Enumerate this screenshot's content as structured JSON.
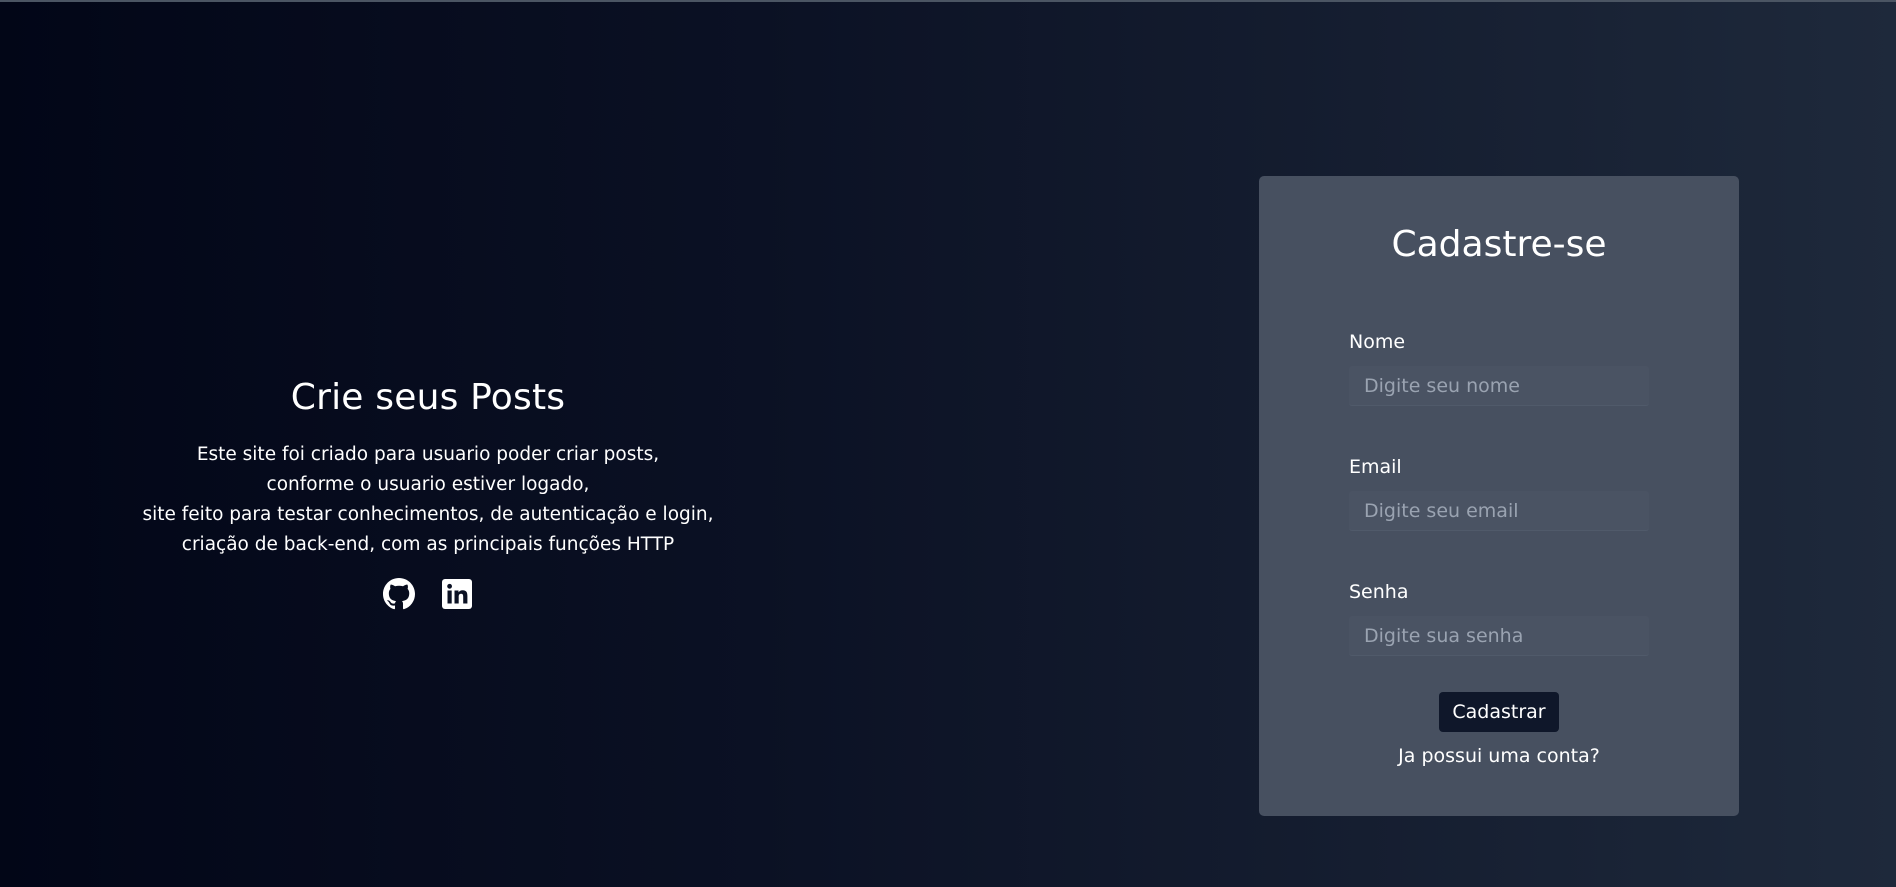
{
  "intro": {
    "title": "Crie seus Posts",
    "description_lines": [
      "Este site foi criado para usuario poder criar posts,",
      "conforme o usuario estiver logado,",
      "site feito para testar conhecimentos, de autenticação e login,",
      "criação de back-end, com as principais funções HTTP"
    ],
    "social_icons": [
      "github-icon",
      "linkedin-icon"
    ]
  },
  "form": {
    "title": "Cadastre-se",
    "fields": {
      "nome": {
        "label": "Nome",
        "placeholder": "Digite seu nome",
        "value": ""
      },
      "email": {
        "label": "Email",
        "placeholder": "Digite seu email",
        "value": ""
      },
      "senha": {
        "label": "Senha",
        "placeholder": "Digite sua senha",
        "value": ""
      }
    },
    "submit_label": "Cadastrar",
    "login_link": "Ja possui uma conta?"
  },
  "colors": {
    "background_start": "#020617",
    "background_end": "#1e293b",
    "card": "#475060",
    "button": "#0f172a",
    "text": "#ffffff",
    "placeholder": "#9aa3b1"
  }
}
